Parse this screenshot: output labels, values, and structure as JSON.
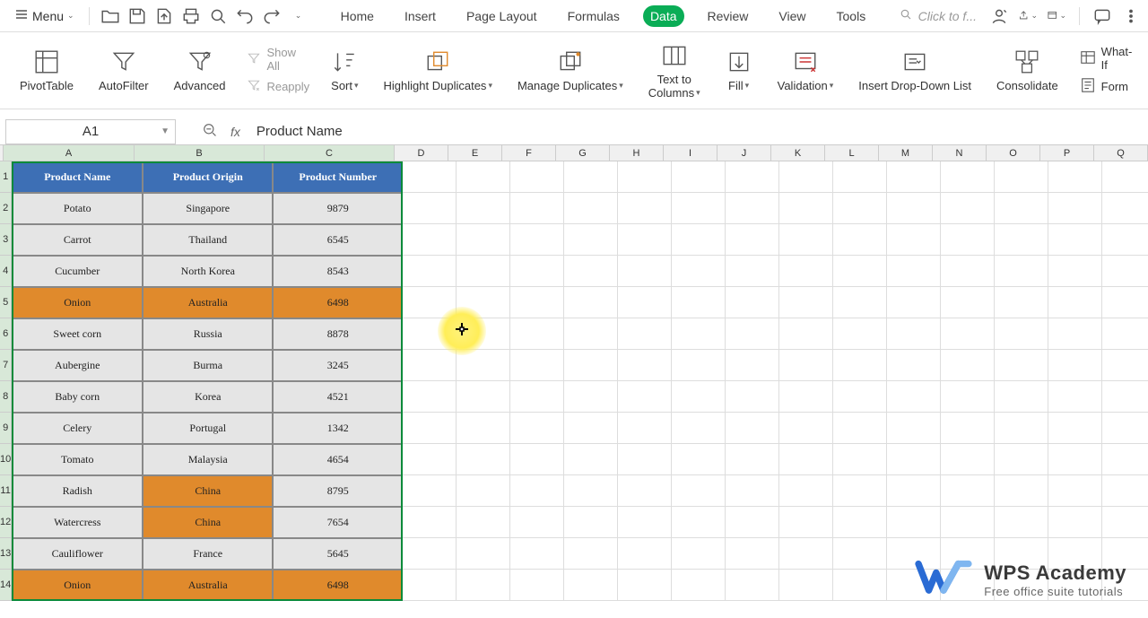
{
  "menubar": {
    "menu_label": "Menu"
  },
  "tabs": [
    "Home",
    "Insert",
    "Page Layout",
    "Formulas",
    "Data",
    "Review",
    "View",
    "Tools"
  ],
  "active_tab": "Data",
  "search_placeholder": "Click to f...",
  "ribbon": {
    "pivot_table": "PivotTable",
    "autofilter": "AutoFilter",
    "advanced": "Advanced",
    "show_all": "Show All",
    "reapply": "Reapply",
    "sort": "Sort",
    "highlight_dup": "Highlight Duplicates",
    "manage_dup": "Manage Duplicates",
    "text_to_columns_1": "Text to",
    "text_to_columns_2": "Columns",
    "fill": "Fill",
    "validation": "Validation",
    "insert_dropdown": "Insert Drop-Down List",
    "consolidate": "Consolidate",
    "whatif": "What-If",
    "form": "Form"
  },
  "formula_bar": {
    "name_box": "A1",
    "formula": "Product Name"
  },
  "columns": [
    "A",
    "B",
    "C",
    "D",
    "E",
    "F",
    "G",
    "H",
    "I",
    "J",
    "K",
    "L",
    "M",
    "N",
    "O",
    "P",
    "Q"
  ],
  "col_widths": {
    "A": 146,
    "B": 145,
    "C": 145,
    "other": 60
  },
  "rows": [
    1,
    2,
    3,
    4,
    5,
    6,
    7,
    8,
    9,
    10,
    11,
    12,
    13,
    14
  ],
  "table": {
    "headers": [
      "Product Name",
      "Product Origin",
      "Product Number"
    ],
    "rows": [
      {
        "name": "Potato",
        "origin": "Singapore",
        "num": "9879",
        "hl": [
          false,
          false,
          false
        ]
      },
      {
        "name": "Carrot",
        "origin": "Thailand",
        "num": "6545",
        "hl": [
          false,
          false,
          false
        ]
      },
      {
        "name": "Cucumber",
        "origin": "North Korea",
        "num": "8543",
        "hl": [
          false,
          false,
          false
        ]
      },
      {
        "name": "Onion",
        "origin": "Australia",
        "num": "6498",
        "hl": [
          true,
          true,
          true
        ]
      },
      {
        "name": "Sweet corn",
        "origin": "Russia",
        "num": "8878",
        "hl": [
          false,
          false,
          false
        ]
      },
      {
        "name": "Aubergine",
        "origin": "Burma",
        "num": "3245",
        "hl": [
          false,
          false,
          false
        ]
      },
      {
        "name": "Baby corn",
        "origin": "Korea",
        "num": "4521",
        "hl": [
          false,
          false,
          false
        ]
      },
      {
        "name": "Celery",
        "origin": "Portugal",
        "num": "1342",
        "hl": [
          false,
          false,
          false
        ]
      },
      {
        "name": "Tomato",
        "origin": "Malaysia",
        "num": "4654",
        "hl": [
          false,
          false,
          false
        ]
      },
      {
        "name": "Radish",
        "origin": "China",
        "num": "8795",
        "hl": [
          false,
          true,
          false
        ]
      },
      {
        "name": "Watercress",
        "origin": "China",
        "num": "7654",
        "hl": [
          false,
          true,
          false
        ]
      },
      {
        "name": "Cauliflower",
        "origin": "France",
        "num": "5645",
        "hl": [
          false,
          false,
          false
        ]
      },
      {
        "name": "Onion",
        "origin": "Australia",
        "num": "6498",
        "hl": [
          true,
          true,
          true
        ]
      }
    ]
  },
  "watermark": {
    "title": "WPS Academy",
    "subtitle": "Free office suite tutorials"
  },
  "colors": {
    "tab_active_bg": "#0aad56",
    "header_bg": "#3d6fb5",
    "highlight_bg": "#e08a2c",
    "selection_border": "#0a8a3a"
  }
}
